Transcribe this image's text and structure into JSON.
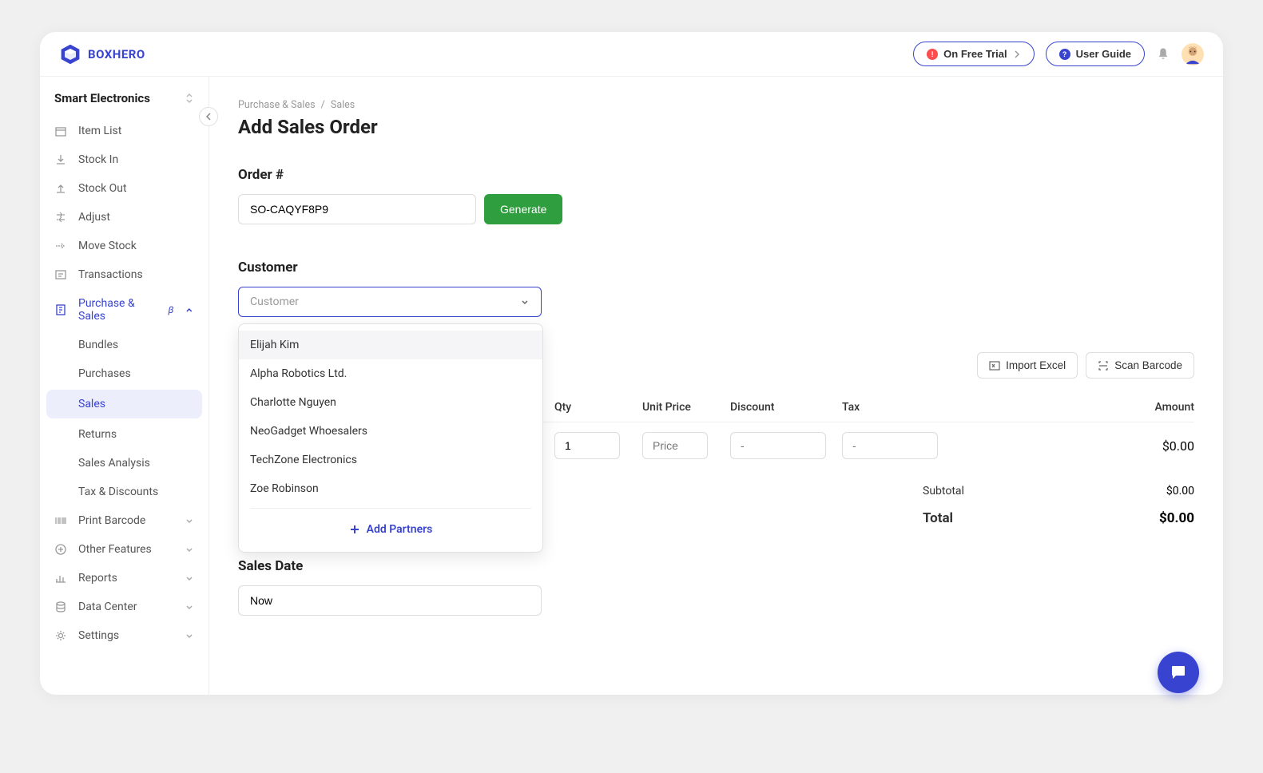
{
  "brand": {
    "name": "BOXHERO"
  },
  "header": {
    "trial": "On Free Trial",
    "guide": "User Guide"
  },
  "sidebar": {
    "team": "Smart Electronics",
    "items": [
      {
        "label": "Item List"
      },
      {
        "label": "Stock In"
      },
      {
        "label": "Stock Out"
      },
      {
        "label": "Adjust"
      },
      {
        "label": "Move Stock"
      },
      {
        "label": "Transactions"
      },
      {
        "label": "Purchase & Sales",
        "beta": "β"
      },
      {
        "label": "Print Barcode"
      },
      {
        "label": "Other Features"
      },
      {
        "label": "Reports"
      },
      {
        "label": "Data Center"
      },
      {
        "label": "Settings"
      }
    ],
    "subs": {
      "ps": [
        "Bundles",
        "Purchases",
        "Sales",
        "Returns",
        "Sales Analysis",
        "Tax & Discounts"
      ]
    }
  },
  "breadcrumb": {
    "a": "Purchase & Sales",
    "b": "Sales"
  },
  "page": {
    "title": "Add Sales Order"
  },
  "order": {
    "label": "Order #",
    "value": "SO-CAQYF8P9",
    "generate": "Generate"
  },
  "customer": {
    "label": "Customer",
    "placeholder": "Customer",
    "options": [
      "Elijah Kim",
      "Alpha Robotics Ltd.",
      "Charlotte Nguyen",
      "NeoGadget Whoesalers",
      "TechZone Electronics",
      "Zoe Robinson"
    ],
    "add": "Add Partners"
  },
  "items_section": {
    "import": "Import Excel",
    "scan": "Scan Barcode",
    "headers": {
      "qty": "Qty",
      "price": "Unit Price",
      "discount": "Discount",
      "tax": "Tax",
      "amount": "Amount"
    },
    "row": {
      "qty": "1",
      "price_ph": "Price",
      "discount_ph": "-",
      "tax_ph": "-",
      "amount": "$0.00"
    },
    "subtotal_label": "Subtotal",
    "subtotal_value": "$0.00",
    "total_label": "Total",
    "total_value": "$0.00"
  },
  "sales_date": {
    "label": "Sales Date",
    "value": "Now"
  }
}
